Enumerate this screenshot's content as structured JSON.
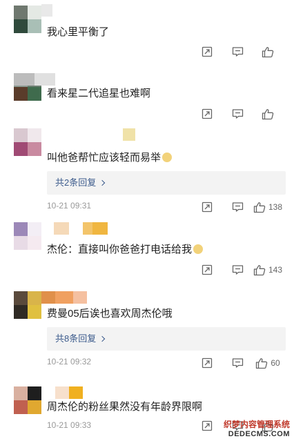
{
  "comments": [
    {
      "text": "我心里平衡了",
      "reply": "",
      "time": "",
      "likes": "",
      "avatar_colors": [
        "#6f786f",
        "#e4e9e4",
        "#2f4a3c",
        "#a9bfb6"
      ],
      "name_colors": [
        "#e9e9e9",
        "#ffffff"
      ]
    },
    {
      "text": "看来星二代追星也难啊",
      "reply": "",
      "time": "",
      "likes": "",
      "avatar_colors": [
        "#8d9b93",
        "#6d7f72",
        "#5a3c2b",
        "#3f6b4d"
      ],
      "name_colors": [
        "#bcbcbc",
        "#e0e0e0"
      ]
    },
    {
      "text": "叫他爸帮忙应该轻而易举",
      "reply": "共2条回复",
      "time": "10-21 09:31",
      "likes": "138",
      "avatar_colors": [
        "#d9c8d0",
        "#f0e8ec",
        "#a04a74",
        "#c98aa0"
      ],
      "name_colors": [
        "#f0e2a8"
      ]
    },
    {
      "text": "杰伦：直接叫你爸爸打电话给我",
      "reply": "",
      "time": "",
      "likes": "143",
      "avatar_colors": [
        "#9c88b8",
        "#f3eef5",
        "#e8dbe6",
        "#f5eaf0"
      ],
      "name_colors": [
        "#f5d9b8",
        "#ffffff",
        "#f3c46a",
        "#f0b640"
      ]
    },
    {
      "text": "费曼05后诶也喜欢周杰伦哦",
      "reply": "共8条回复",
      "time": "10-21 09:32",
      "likes": "60",
      "avatar_colors": [
        "#5a4a3c",
        "#d9b44a",
        "#2f2a24",
        "#e0c040"
      ],
      "name_colors": [
        "#e0904a",
        "#f0a060",
        "#f5c0a0"
      ]
    },
    {
      "text": "周杰伦的粉丝果然没有年龄界限啊",
      "reply": "",
      "time": "10-21 09:33",
      "likes": "",
      "avatar_colors": [
        "#d9b0a0",
        "#1e1e1e",
        "#c06050",
        "#e0a830"
      ],
      "name_colors": [
        "#f7e0cc",
        "#f0b020"
      ]
    }
  ],
  "icons": {
    "share": "share-icon",
    "comment": "comment-icon",
    "like": "thumbs-up-icon"
  },
  "watermark": {
    "line1": "织梦内容管理系统",
    "line2": "DEDECMS.COM"
  }
}
